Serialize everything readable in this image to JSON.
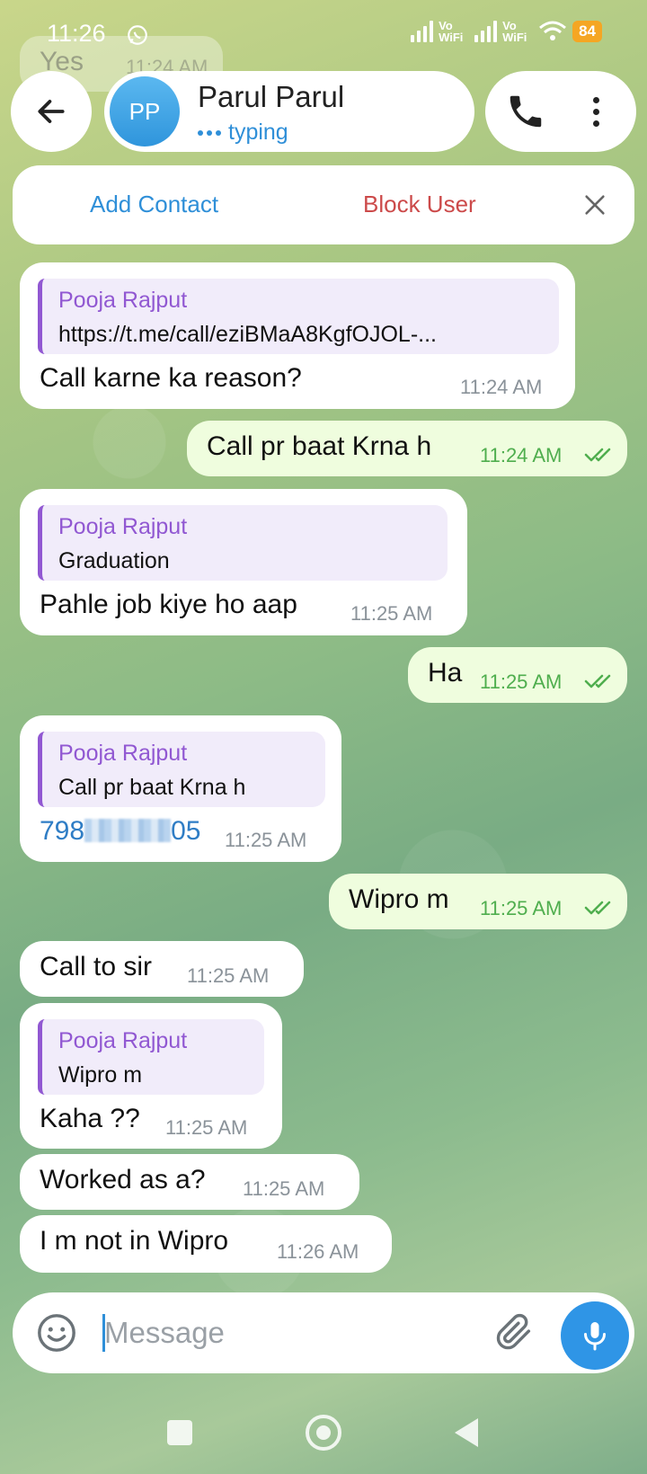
{
  "status_bar": {
    "time": "11:26",
    "network_1": "Vo WiFi",
    "network_2": "Vo WiFi",
    "battery": "84"
  },
  "ghost_message": {
    "text": "Yes",
    "time": "11:24 AM"
  },
  "header": {
    "avatar_initials": "PP",
    "contact_name": "Parul Parul",
    "status": "typing"
  },
  "action_bar": {
    "add_contact": "Add Contact",
    "block_user": "Block User"
  },
  "messages": [
    {
      "direction": "in",
      "quote_name": "Pooja Rajput",
      "quote_text": "https://t.me/call/eziBMaA8KgfOJOL-...",
      "text": "Call karne ka reason?",
      "time": "11:24 AM"
    },
    {
      "direction": "out",
      "text": "Call pr baat Krna h",
      "time": "11:24 AM"
    },
    {
      "direction": "in",
      "quote_name": "Pooja Rajput",
      "quote_text": "Graduation",
      "text": "Pahle job kiye ho aap",
      "time": "11:25 AM"
    },
    {
      "direction": "out",
      "text": "Ha",
      "time": "11:25 AM"
    },
    {
      "direction": "in",
      "quote_name": "Pooja Rajput",
      "quote_text": "Call pr baat Krna h",
      "text_prefix": "798",
      "text_suffix": "05",
      "time": "11:25 AM"
    },
    {
      "direction": "out",
      "text": "Wipro m",
      "time": "11:25 AM"
    },
    {
      "direction": "in",
      "text": "Call to sir",
      "time": "11:25 AM"
    },
    {
      "direction": "in",
      "quote_name": "Pooja Rajput",
      "quote_text": "Wipro m",
      "text": "Kaha ??",
      "time": "11:25 AM"
    },
    {
      "direction": "in",
      "text": "Worked as a?",
      "time": "11:25 AM"
    },
    {
      "direction": "in",
      "text": "I m not in Wipro",
      "time": "11:26 AM"
    }
  ],
  "composer": {
    "placeholder": "Message",
    "value": ""
  },
  "icons": {
    "back": "arrow-left-icon",
    "call": "phone-icon",
    "menu": "more-vertical-icon",
    "close": "close-icon",
    "emoji": "smile-icon",
    "attach": "paperclip-icon",
    "mic": "microphone-icon"
  },
  "colors": {
    "accent": "#2f8fd8",
    "block": "#cc4a4a",
    "quote": "#9158d2",
    "outgoing_bubble": "#effdde",
    "outgoing_time": "#4fae4e"
  }
}
